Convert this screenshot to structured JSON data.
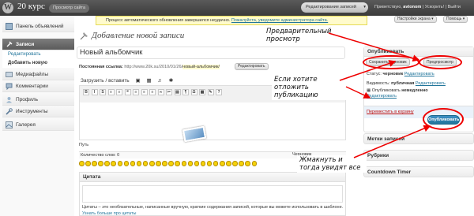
{
  "adminbar": {
    "site_name": "20 курс",
    "view_site": "Просмотр сайта",
    "edit_posts": "Редактирование записей",
    "greeting": "Приветствую,",
    "username": "avtonom",
    "links": "| Ускорить! | Выйти"
  },
  "notice": {
    "text": "Процесс автоматического обновления завершился неудачно.",
    "link": "Пожалуйста, уведомите администратора сайта."
  },
  "screen_options": "Настройки экрана ▾",
  "help": "Помощь ▾",
  "sidebar": {
    "dashboard": "Панель объявлений",
    "posts": "Записи",
    "posts_edit": "Редактировать",
    "posts_add": "Добавить новую",
    "media": "Медиафайлы",
    "comments": "Комментарии",
    "profile": "Профиль",
    "tools": "Инструменты",
    "gallery": "Галерея"
  },
  "page": {
    "title": "Добавление новой записи",
    "post_title": "Новый альбомчик",
    "permalink_label": "Постоянная ссылка:",
    "permalink_url": "http://www.20k.su/2010/01/26/",
    "permalink_slug": "новый-альбомчик/",
    "edit_button": "Редактировать",
    "upload_label": "Загрузить / вставить"
  },
  "toolbar": {
    "buttons": [
      "B",
      "I",
      "S",
      "≡",
      "≡",
      "❝",
      "≡",
      "≡",
      "≡",
      "∞",
      "✂",
      "▤",
      "¶",
      "Ω",
      "▦",
      "✎",
      "?"
    ]
  },
  "editor": {
    "path": "Путь",
    "word_count": "Количество слов: 0",
    "draft_saved": "Черновик"
  },
  "excerpt": {
    "title": "Цитата",
    "hint": "Цитаты – это необязательные, написанные вручную, краткие содержания записей, которые вы можете использовать в шаблоне.",
    "more": "Узнать больше про цитаты"
  },
  "publish": {
    "title": "Опубликовать",
    "save_draft": "Сохранить черновик",
    "preview": "Предпросмотр",
    "status_label": "Статус:",
    "status_value": "черновик",
    "visibility_label": "Видимость:",
    "visibility_value": "публичная",
    "schedule_label": "Опубликовать",
    "schedule_value": "немедленно",
    "edit_link": "Редактировать",
    "trash": "Переместить в корзину",
    "publish_button": "Опубликовать"
  },
  "side_boxes": {
    "tags": "Метки записей",
    "categories": "Рубрики",
    "timer": "Countdown Timer"
  },
  "annotations": {
    "preview_note": "Предварительный просмотр",
    "postpone_note": "Если хотите отложить публикацию",
    "publish_note": "Жмакнуть и тогда увидят все"
  },
  "colors": {
    "annotation_red": "#e00000",
    "link_blue": "#21759b",
    "publish_blue": "#21759b"
  }
}
